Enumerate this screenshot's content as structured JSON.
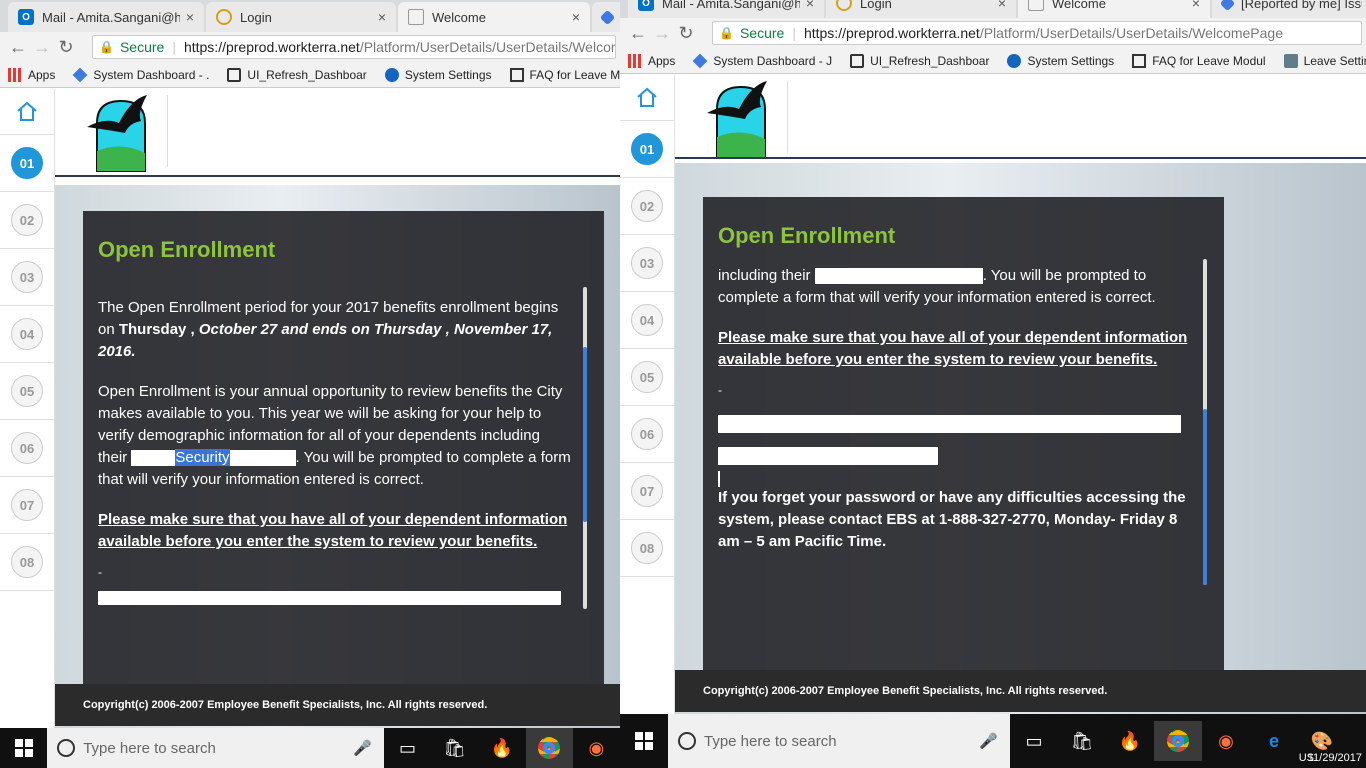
{
  "left": {
    "tabs": [
      {
        "label": "Mail - Amita.Sangani@h",
        "close": "×"
      },
      {
        "label": "Login",
        "close": "×"
      },
      {
        "label": "Welcome",
        "close": "×"
      }
    ],
    "secure_label": "Secure",
    "url_host": "https://preprod.workterra.net",
    "url_path": "/Platform/UserDetails/UserDetails/Welcom",
    "bookmarks": [
      "Apps",
      "System Dashboard - .",
      "UI_Refresh_Dashboar",
      "System Settings",
      "FAQ for Leave Mod"
    ],
    "steps": [
      "01",
      "02",
      "03",
      "04",
      "05",
      "06",
      "07",
      "08"
    ],
    "card": {
      "title": "Open Enrollment",
      "p1_a": "The Open Enrollment period for your 2017 benefits enrollment begins on ",
      "p1_b": "Thursday , ",
      "p1_c": "October 27 and ends on Thursday , November 17, 2016.",
      "p2": "Open Enrollment is your annual opportunity to review benefits the City makes available to you. This year we will be asking for your help to verify demographic information for all of your dependents including their",
      "selected": "Security",
      "p2_tail": ".  You will be prompted to complete a form that will verify your information entered is correct.",
      "p3": "Please make sure that you have all of your dependent information available before you enter the system to review your benefits.",
      "dash": "-"
    },
    "footer": "Copyright(c) 2006-2007 Employee Benefit Specialists, Inc. All rights reserved.",
    "taskbar_search": "Type here to search"
  },
  "right": {
    "tabs": [
      {
        "label": "Mail - Amita.Sangani@h",
        "close": "×"
      },
      {
        "label": "Login",
        "close": "×"
      },
      {
        "label": "Welcome",
        "close": "×"
      },
      {
        "label": "[Reported by me] Issue",
        "close": ""
      }
    ],
    "secure_label": "Secure",
    "url_host": "https://preprod.workterra.net",
    "url_path": "/Platform/UserDetails/UserDetails/WelcomePage",
    "bookmarks": [
      "Apps",
      "System Dashboard - J",
      "UI_Refresh_Dashboar",
      "System Settings",
      "FAQ for Leave Modul",
      "Leave Settings"
    ],
    "steps": [
      "01",
      "02",
      "03",
      "04",
      "05",
      "06",
      "07",
      "08"
    ],
    "card": {
      "title": "Open Enrollment",
      "p2_head": "including their",
      "p2_tail": ".  You will be prompted to complete a form that will verify your information entered is correct.",
      "p3": "Please make sure that you have all of your dependent information available before you enter the system to review your benefits.",
      "dash": "-",
      "p4": "If you forget your password or have any difficulties accessing the system, please contact EBS at 1-888-327-2770, Monday- Friday 8 am – 5 am Pacific Time."
    },
    "footer": "Copyright(c) 2006-2007 Employee Benefit Specialists, Inc. All rights reserved.",
    "taskbar_search": "Type here to search",
    "tray_lang": "US",
    "tray_date": "11/29/2017"
  },
  "colors": {
    "accent_green": "#8cc43c",
    "step_active": "#2196d8",
    "secure_green": "#0b8043"
  }
}
